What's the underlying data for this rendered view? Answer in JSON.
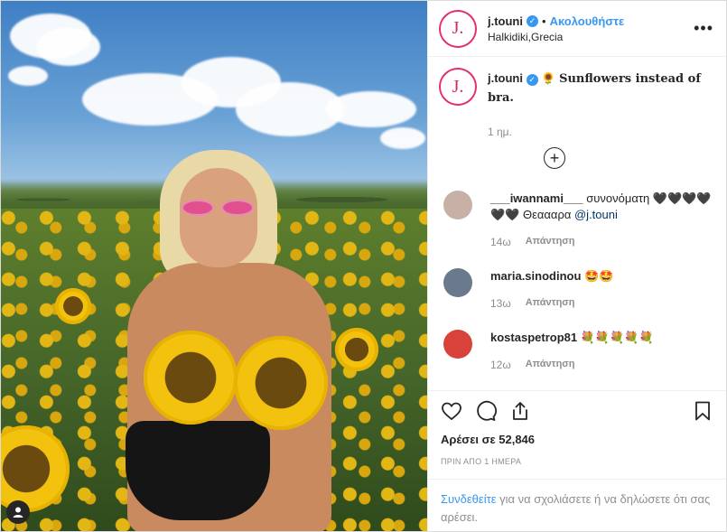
{
  "post": {
    "username": "j.touni",
    "avatar_letter": "J.",
    "follow_label": "Ακολουθήστε",
    "location": "Halkidiki,Grecia",
    "more_label": "•••"
  },
  "caption": {
    "username": "j.touni",
    "emoji": "🌻",
    "text": "Sunflowers instead of bra.",
    "time": "1 ημ."
  },
  "comments": [
    {
      "username": "___iwannami___",
      "text": "συνονόματη 🖤🖤🖤🖤🖤🖤 Θεαααρα",
      "mention": "@j.touni",
      "time": "14ω",
      "reply": "Απάντηση",
      "avatar_color": "#c7b0a6"
    },
    {
      "username": "maria.sinodinou",
      "text": "🤩🤩",
      "mention": "",
      "time": "13ω",
      "reply": "Απάντηση",
      "avatar_color": "#6a7a8c"
    },
    {
      "username": "kostaspetrop81",
      "text": "💐💐💐💐💐",
      "mention": "",
      "time": "12ω",
      "reply": "Απάντηση",
      "avatar_color": "#d9423b"
    }
  ],
  "actions": {
    "like_icon": "heart-icon",
    "comment_icon": "comment-icon",
    "share_icon": "share-icon",
    "save_icon": "bookmark-icon"
  },
  "likes_text": "Αρέσει σε 52,846",
  "date_text": "ΠΡΙΝ ΑΠΟ 1 ΗΜΕΡΑ",
  "login_prompt": {
    "link": "Συνδεθείτε",
    "text": " για να σχολιάσετε ή να δηλώσετε ότι σας αρέσει."
  },
  "colors": {
    "accent": "#3897f0",
    "avatar_ring": "#e1306c"
  }
}
